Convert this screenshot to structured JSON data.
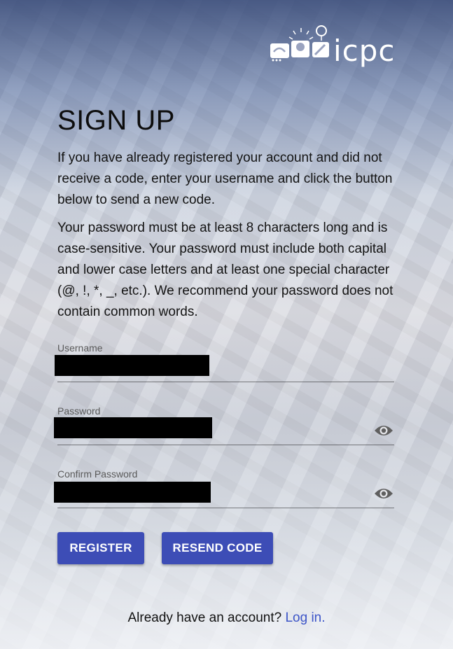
{
  "logo": {
    "text": "icpc",
    "icon_name": "icpc-logo-icon"
  },
  "page": {
    "title": "SIGN UP",
    "paragraph1": "If you have already registered your account and did not receive a code, enter your username and click the button below to send a new code.",
    "paragraph2": "Your password must be at least 8 characters long and is case-sensitive. Your password must include both capital and lower case letters and at least one special character (@, !, *, _, etc.). We recommend your password does not contain common words."
  },
  "form": {
    "username_label": "Username",
    "password_label": "Password",
    "confirm_label": "Confirm Password",
    "visibility_icon": "eye-icon"
  },
  "buttons": {
    "register": "REGISTER",
    "resend": "RESEND CODE"
  },
  "footer": {
    "prompt": "Already have an account?",
    "link": "Log in."
  },
  "colors": {
    "accent": "#3d4db6",
    "link": "#3d55c8",
    "redaction": "#000000"
  }
}
